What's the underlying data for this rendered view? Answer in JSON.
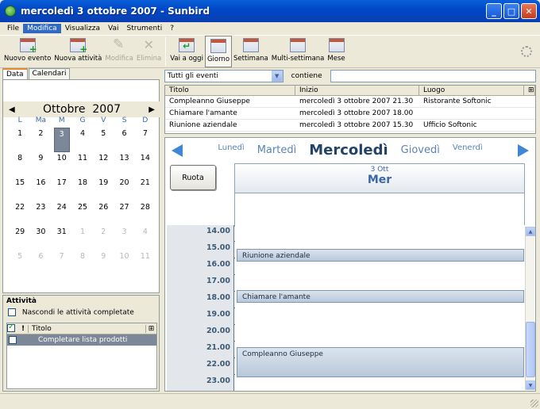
{
  "window": {
    "title": "mercoledì 3 ottobre 2007 - Sunbird"
  },
  "menu": [
    "File",
    "Modifica",
    "Visualizza",
    "Vai",
    "Strumenti",
    "?"
  ],
  "toolbar": {
    "new_event": "Nuovo evento",
    "new_task": "Nuova attività",
    "edit": "Modifica",
    "delete": "Elimina",
    "go_today": "Vai a oggi",
    "day": "Giorno",
    "week": "Settimana",
    "multiweek": "Multi-settimana",
    "month": "Mese"
  },
  "left": {
    "tabs": [
      "Data",
      "Calendari"
    ],
    "calendar": {
      "month": "Ottobre",
      "year": "2007",
      "weekdays": [
        "L",
        "Ma",
        "M",
        "G",
        "V",
        "S",
        "D"
      ],
      "weeks": [
        [
          "1",
          "2",
          "3",
          "4",
          "5",
          "6",
          "7"
        ],
        [
          "8",
          "9",
          "10",
          "11",
          "12",
          "13",
          "14"
        ],
        [
          "15",
          "16",
          "17",
          "18",
          "19",
          "20",
          "21"
        ],
        [
          "22",
          "23",
          "24",
          "25",
          "26",
          "27",
          "28"
        ],
        [
          "29",
          "30",
          "31",
          "1",
          "2",
          "3",
          "4"
        ],
        [
          "5",
          "6",
          "7",
          "8",
          "9",
          "10",
          "11"
        ]
      ]
    },
    "tasks": {
      "title": "Attività",
      "hide_completed": "Nascondi le attività completate",
      "column_title": "Titolo",
      "items": [
        "Completare lista prodotti"
      ]
    }
  },
  "filter": {
    "selected": "Tutti gli eventi",
    "contains_label": "contiene",
    "contains_value": ""
  },
  "event_list": {
    "columns": [
      "Titolo",
      "Inizio",
      "Luogo"
    ],
    "rows": [
      [
        "Compleanno Giuseppe",
        "mercoledì 3 ottobre 2007 21.30",
        "Ristorante Softonic"
      ],
      [
        "Chiamare l'amante",
        "mercoledì 3 ottobre 2007 18.00",
        ""
      ],
      [
        "Riunione aziendale",
        "mercoledì 3 ottobre 2007 15.30",
        "Ufficio Softonic"
      ]
    ]
  },
  "day_view": {
    "nav_days": [
      "Lunedì",
      "Martedì",
      "Mercoledì",
      "Giovedì",
      "Venerdì"
    ],
    "rotate_button": "Ruota",
    "header_date": "3 Ott",
    "header_weekday": "Mer",
    "hours": [
      "14.00",
      "15.00",
      "16.00",
      "17.00",
      "18.00",
      "19.00",
      "20.00",
      "21.00",
      "22.00",
      "23.00"
    ],
    "events": [
      "Riunione aziendale",
      "Chiamare l'amante",
      "Compleanno Giuseppe"
    ]
  }
}
